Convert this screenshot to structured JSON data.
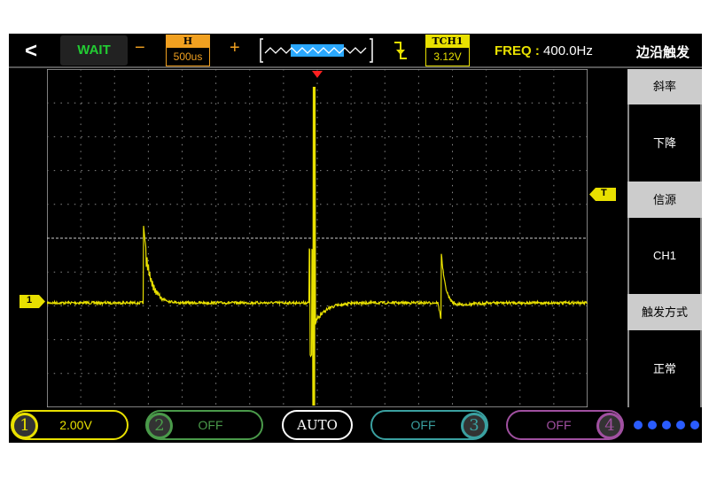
{
  "topbar": {
    "back": "<",
    "status": "WAIT",
    "minus": "−",
    "plus": "+",
    "timebase_label": "H",
    "timebase": "500us",
    "trigger_label": "TCH1",
    "trigger_level": "3.12V",
    "freq_label": "FREQ :",
    "freq_value": "400.0Hz",
    "mode": "边沿触发"
  },
  "side_menu": [
    {
      "label": "斜率",
      "value": "下降"
    },
    {
      "label": "信源",
      "value": "CH1"
    },
    {
      "label": "触发方式",
      "value": "正常"
    }
  ],
  "markers": {
    "channel": "1",
    "trigger": "T"
  },
  "channels": [
    {
      "num": "1",
      "value": "2.00V",
      "color": "#e8e000"
    },
    {
      "num": "2",
      "value": "OFF",
      "color": "#4a9a4a"
    },
    {
      "num": "3",
      "value": "OFF",
      "color": "#3aa0a0"
    },
    {
      "num": "4",
      "value": "OFF",
      "color": "#a050a0"
    }
  ],
  "run_mode": "AUTO",
  "colors": {
    "ch1": "#e8e000",
    "timebase": "#f0a020",
    "trigger_arrow": "#ff2020",
    "highlight": "#2aa8ff"
  }
}
